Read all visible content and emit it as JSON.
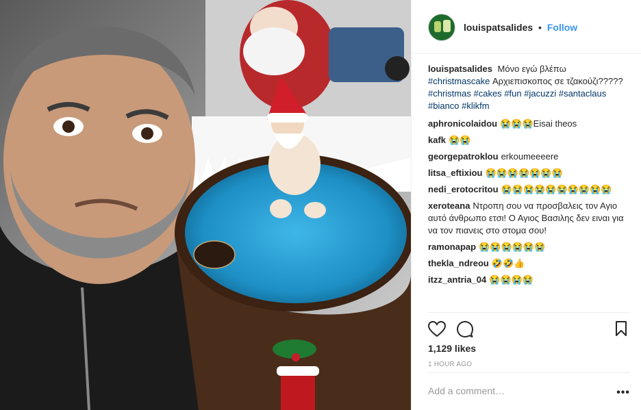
{
  "post": {
    "username": "louispatsalides",
    "dot": "•",
    "follow_label": "Follow",
    "caption_user": "louispatsalides",
    "caption_text": "Μόνο εγώ βλέπω",
    "caption_tag1": "#christmascake",
    "caption_text2": "Αρχιεπισκοπος σε τζακούζι?????",
    "caption_tags2": [
      "#christmas",
      "#cakes",
      "#fun",
      "#jacuzzi",
      "#santaclaus",
      "#bianco",
      "#klikfm"
    ]
  },
  "comments": [
    {
      "user": "aphronicolaidou",
      "text": "😭😭😭Eisai theos"
    },
    {
      "user": "kafk",
      "text": "😭😭"
    },
    {
      "user": "georgepatroklou",
      "text": "erkoumeeeere"
    },
    {
      "user": "litsa_eftixiou",
      "text": "😭😭😭😭😭😭😭"
    },
    {
      "user": "nedi_erotocritou",
      "text": "😭😭😭😭😭😭😭😭😭😭"
    },
    {
      "user": "xeroteana",
      "text": "Ντροπη σου να προσβαλεις τον Αγιο αυτό άνθρωπο ετσι! Ο Αγιος Βασιλης δεν ειναι για να τον πιανεις στο στομα σου!"
    },
    {
      "user": "ramonapap",
      "text": "😭😭😭😭😭😭"
    },
    {
      "user": "thekla_ndreou",
      "text": "🤣🤣👍"
    },
    {
      "user": "itzz_antria_04",
      "text": "😭😭😭😭"
    }
  ],
  "actions": {
    "likes": "1,129 likes",
    "time": "1 HOUR AGO",
    "comment_placeholder": "Add a comment…",
    "more": "•••"
  },
  "icons": {
    "heart": "heart-icon",
    "comment": "comment-icon",
    "bookmark": "bookmark-icon"
  }
}
